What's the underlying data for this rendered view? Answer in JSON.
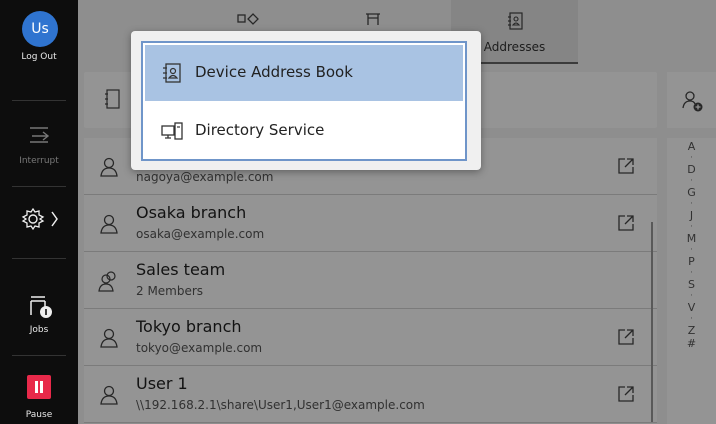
{
  "rail": {
    "avatar_text": "Us",
    "logout_label": "Log Out",
    "interrupt_label": "Interrupt",
    "jobs_label": "Jobs",
    "pause_label": "Pause"
  },
  "tabs": [
    {
      "label": "",
      "icon": "device-icon"
    },
    {
      "label": "",
      "icon": "table-icon"
    },
    {
      "label": "Addresses",
      "icon": "address-book-icon",
      "active": true
    }
  ],
  "contacts": [
    {
      "name": "",
      "sub": "nagoya@example.com",
      "type": "person",
      "external": true
    },
    {
      "name": "Osaka branch",
      "sub": "osaka@example.com",
      "type": "person",
      "external": true
    },
    {
      "name": "Sales team",
      "sub": "2 Members",
      "type": "group",
      "external": false
    },
    {
      "name": "Tokyo branch",
      "sub": "tokyo@example.com",
      "type": "person",
      "external": true
    },
    {
      "name": "User 1",
      "sub": "\\\\192.168.2.1\\share\\User1,User1@example.com",
      "type": "person",
      "external": true
    }
  ],
  "alpha_index": [
    "A",
    "·",
    "D",
    "·",
    "G",
    "·",
    "J",
    "·",
    "M",
    "·",
    "P",
    "·",
    "S",
    "·",
    "V",
    "·",
    "Z",
    "#"
  ],
  "dropdown": {
    "options": [
      {
        "label": "Device Address Book",
        "icon": "address-book-icon",
        "selected": true
      },
      {
        "label": "Directory Service",
        "icon": "directory-service-icon",
        "selected": false
      }
    ]
  },
  "colors": {
    "accent": "#a9c3e3",
    "avatar": "#2f74d0",
    "pause": "#e8294a"
  }
}
